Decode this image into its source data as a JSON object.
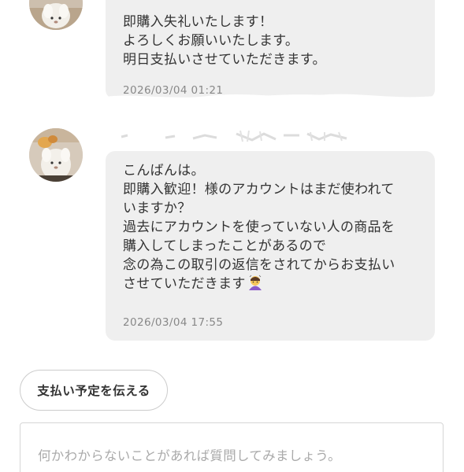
{
  "messages": [
    {
      "lines": "即購入失礼いたします！\nよろしくお願いいたします。\n明日支払いさせていただきます。",
      "timestamp": "2026/03/04 01:21"
    },
    {
      "lines": "こんばんは。\n即購入歓迎！様のアカウントはまだ使われて\nいますか？\n過去にアカウントを使っていない人の商品を\n購入してしまったことがあるので\n念の為この取引の返信をされてからお支払い\nさせていただきます",
      "emoji": "bowing-person-emoji",
      "timestamp": "2026/03/04 17:55"
    }
  ],
  "actions": {
    "payment_schedule_button": "支払い予定を伝える"
  },
  "composer": {
    "placeholder": "何かわからないことがあれば質問してみましょう。"
  },
  "colors": {
    "bubble_background": "#efefef",
    "timestamp": "#888888",
    "placeholder": "#aaaaaa",
    "border": "#cccccc"
  }
}
